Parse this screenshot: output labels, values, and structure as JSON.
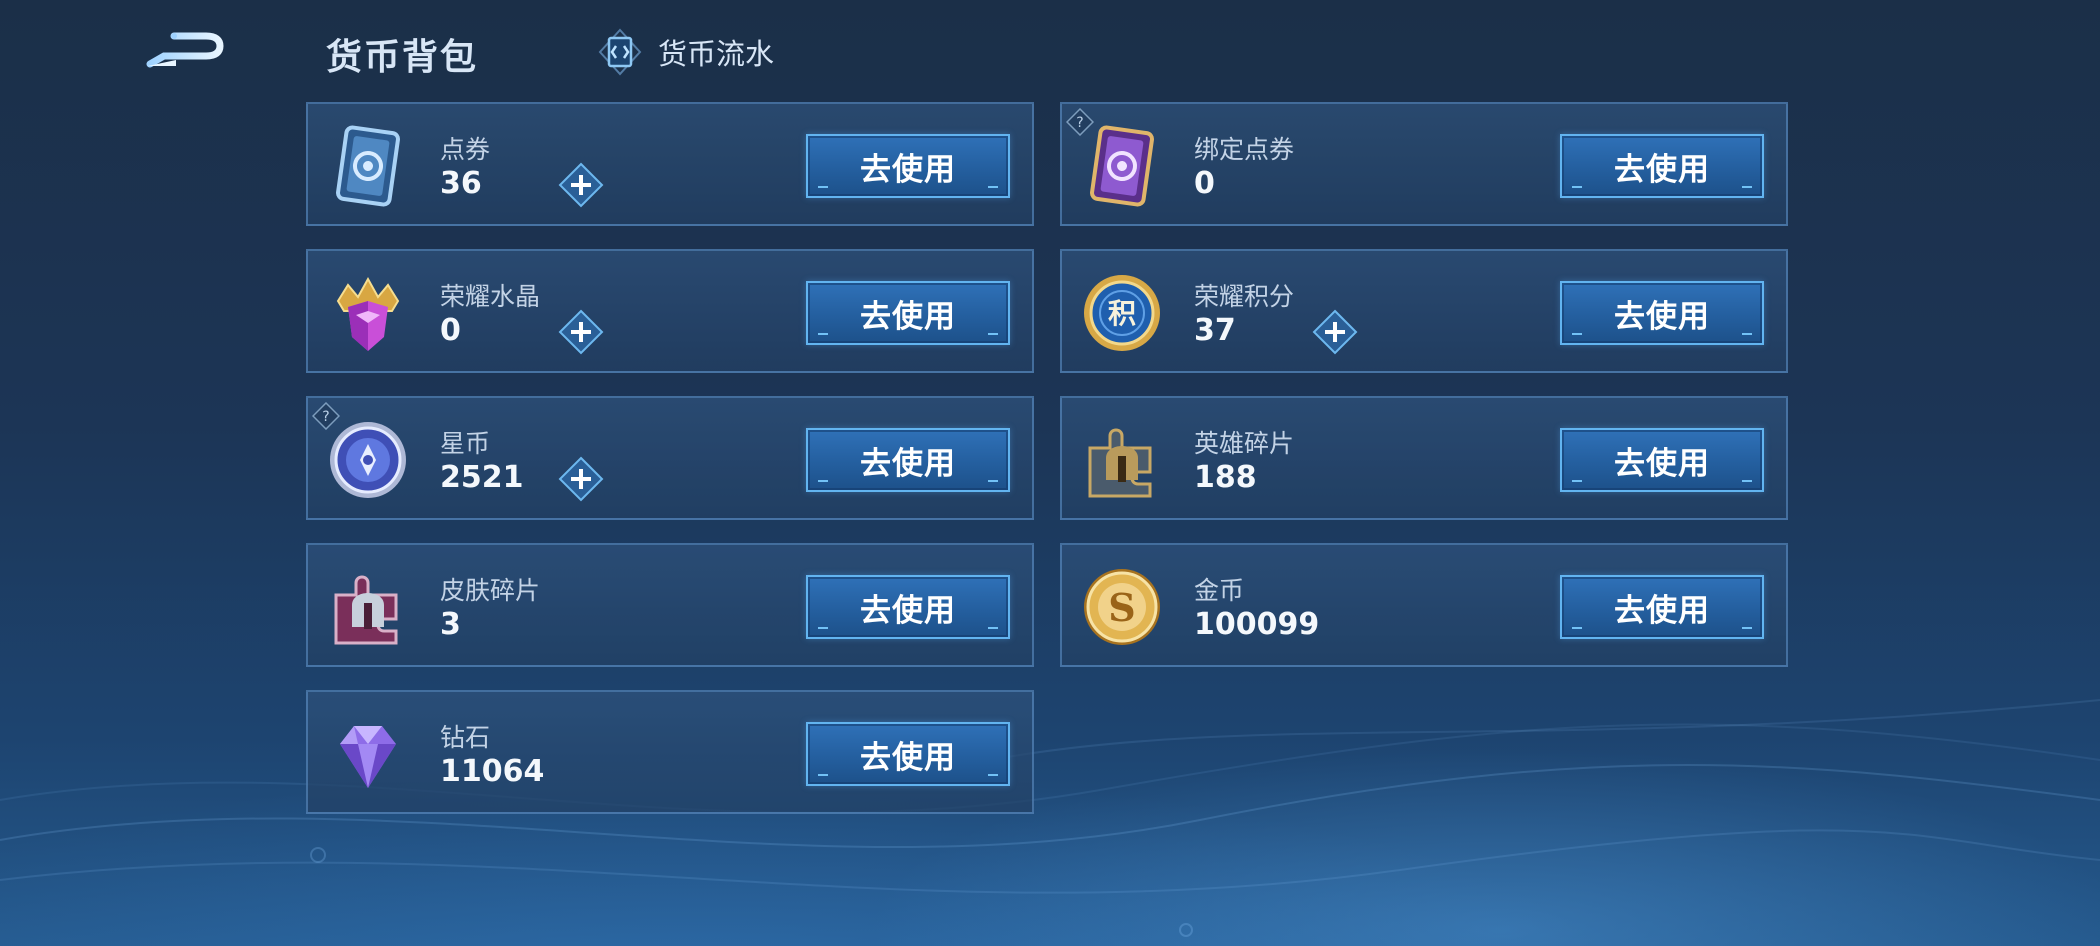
{
  "header": {
    "title": "货币背包",
    "flow_tab_label": "货币流水"
  },
  "use_label": "去使用",
  "items": [
    {
      "name": "点券",
      "amount": "36",
      "icon": "coupon-card-icon",
      "color": "#6a9ccc",
      "has_plus": true,
      "has_help": false
    },
    {
      "name": "绑定点券",
      "amount": "0",
      "icon": "bound-coupon-card-icon",
      "color": "#8f5cc8",
      "has_plus": false,
      "has_help": true
    },
    {
      "name": "荣耀水晶",
      "amount": "0",
      "icon": "glory-crystal-icon",
      "color": "#c94fd8",
      "has_plus": true,
      "has_help": false
    },
    {
      "name": "荣耀积分",
      "amount": "37",
      "icon": "glory-points-coin-icon",
      "color": "#2f76c8",
      "has_plus": true,
      "has_help": false
    },
    {
      "name": "星币",
      "amount": "2521",
      "icon": "star-coin-icon",
      "color": "#6b7ee0",
      "has_plus": true,
      "has_help": true
    },
    {
      "name": "英雄碎片",
      "amount": "188",
      "icon": "hero-fragment-icon",
      "color": "#b99b5c",
      "has_plus": false,
      "has_help": false
    },
    {
      "name": "皮肤碎片",
      "amount": "3",
      "icon": "skin-fragment-icon",
      "color": "#c0487a",
      "has_plus": false,
      "has_help": false
    },
    {
      "name": "金币",
      "amount": "100099",
      "icon": "gold-coin-icon",
      "color": "#d6a445",
      "has_plus": false,
      "has_help": false
    },
    {
      "name": "钻石",
      "amount": "11064",
      "icon": "diamond-icon",
      "color": "#9b7ef2",
      "has_plus": false,
      "has_help": false
    }
  ]
}
